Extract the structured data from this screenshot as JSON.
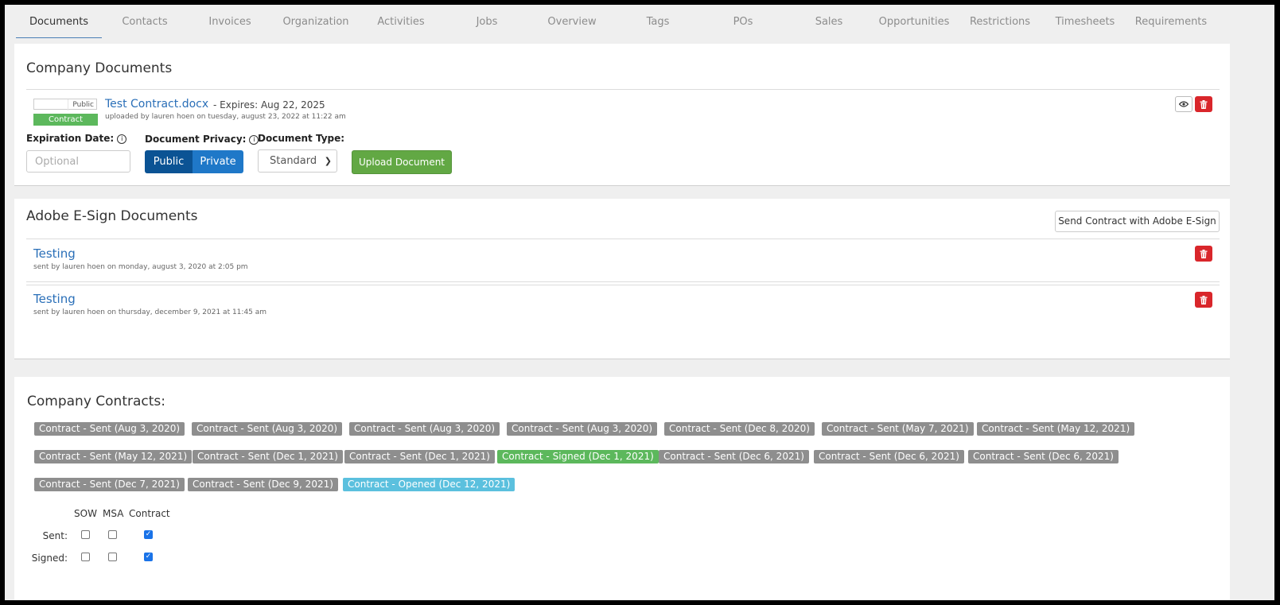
{
  "tabs": [
    {
      "label": "Documents",
      "active": true
    },
    {
      "label": "Contacts"
    },
    {
      "label": "Invoices"
    },
    {
      "label": "Organization"
    },
    {
      "label": "Activities"
    },
    {
      "label": "Jobs"
    },
    {
      "label": "Overview"
    },
    {
      "label": "Tags"
    },
    {
      "label": "POs"
    },
    {
      "label": "Sales"
    },
    {
      "label": "Opportunities"
    },
    {
      "label": "Restrictions"
    },
    {
      "label": "Timesheets"
    },
    {
      "label": "Requirements"
    }
  ],
  "company_documents": {
    "title": "Company Documents",
    "document": {
      "privacy_label": "Public",
      "type_badge": "Contract",
      "name": "Test Contract.docx",
      "expires": "- Expires: Aug 22, 2025",
      "uploaded_meta": "uploaded by lauren hoen on tuesday, august 23, 2022 at 11:22 am"
    },
    "form": {
      "expiration_label": "Expiration Date:",
      "expiration_placeholder": "Optional",
      "privacy_label": "Document Privacy:",
      "privacy_public": "Public",
      "privacy_private": "Private",
      "type_label": "Document Type:",
      "type_value": "Standard",
      "upload_button": "Upload Document",
      "info_glyph": "i"
    },
    "icons": {
      "view": "eye-icon",
      "delete": "trash-icon"
    }
  },
  "esign": {
    "title": "Adobe E-Sign Documents",
    "send_button": "Send Contract with Adobe E-Sign",
    "items": [
      {
        "name": "Testing",
        "meta": "sent by lauren hoen on monday, august 3, 2020 at 2:05 pm"
      },
      {
        "name": "Testing",
        "meta": "sent by lauren hoen on thursday, december 9, 2021 at 11:45 am"
      }
    ]
  },
  "contracts": {
    "title": "Company Contracts:",
    "badges_row1": [
      "Contract - Sent (Aug 3, 2020)",
      "Contract - Sent (Aug 3, 2020)",
      "Contract - Sent (Aug 3, 2020)",
      "Contract - Sent (Aug 3, 2020)",
      "Contract - Sent (Dec 8, 2020)",
      "Contract - Sent (May 7, 2021)",
      "Contract - Sent (May 12, 2021)"
    ],
    "badges_row2": [
      "Contract - Sent (May 12, 2021)",
      "Contract - Sent (Dec 1, 2021)",
      "Contract - Sent (Dec 1, 2021)",
      "Contract - Signed (Dec 1, 2021)",
      "Contract - Sent (Dec 6, 2021)",
      "Contract - Sent (Dec 6, 2021)",
      "Contract - Sent (Dec 6, 2021)"
    ],
    "badges_row3": [
      "Contract - Sent (Dec 7, 2021)",
      "Contract - Sent (Dec 9, 2021)",
      "Contract - Opened (Dec 12, 2021)"
    ],
    "colors": {
      "sent": "#8e8e8e",
      "signed": "#5cb85c",
      "opened": "#5bc0de"
    },
    "checkbox_headers": [
      "SOW",
      "MSA",
      "Contract"
    ],
    "rows": [
      {
        "label": "Sent:",
        "values": [
          false,
          false,
          true
        ]
      },
      {
        "label": "Signed:",
        "values": [
          false,
          false,
          true
        ]
      }
    ]
  }
}
